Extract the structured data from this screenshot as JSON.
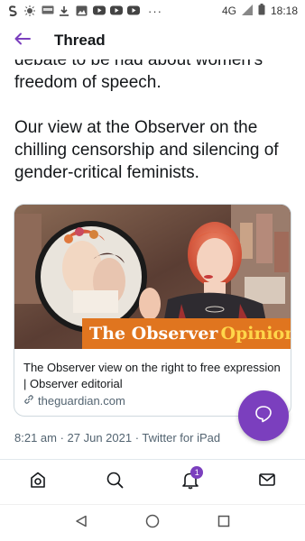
{
  "status_bar": {
    "network": "4G",
    "time": "18:18",
    "icons": [
      "s-app-icon",
      "brightness-icon",
      "nfc-card-icon",
      "download-icon",
      "image-icon",
      "youtube-icon",
      "youtube-icon",
      "youtube-icon"
    ],
    "more": "···"
  },
  "header": {
    "title": "Thread",
    "back_icon": "back-arrow-icon"
  },
  "tweet": {
    "text_para1": "debate to be had about women's freedom of speech.",
    "text_para2": "Our view at the Observer on the chilling censorship and silencing of gender-critical feminists.",
    "card": {
      "image_banner_part1": "The Observer",
      "image_banner_part2": "Opinions",
      "title": "The Observer view on the right to free expression | Observer editorial",
      "domain": "theguardian.com",
      "domain_icon": "link-icon"
    },
    "meta": "8:21 am · 27 Jun 2021 · Twitter for iPad"
  },
  "fab": {
    "icon": "compose-reply-icon"
  },
  "bottom_nav": {
    "items": [
      {
        "name": "home-icon"
      },
      {
        "name": "search-icon"
      },
      {
        "name": "notifications-icon",
        "badge": "1"
      },
      {
        "name": "messages-icon"
      }
    ]
  },
  "system_nav": {
    "items": [
      "back-triangle-icon",
      "home-circle-icon",
      "recents-square-icon"
    ]
  },
  "colors": {
    "accent": "#7b3fbe",
    "text": "#14171a",
    "secondary_text": "#536471",
    "banner_orange": "#e0751f"
  }
}
